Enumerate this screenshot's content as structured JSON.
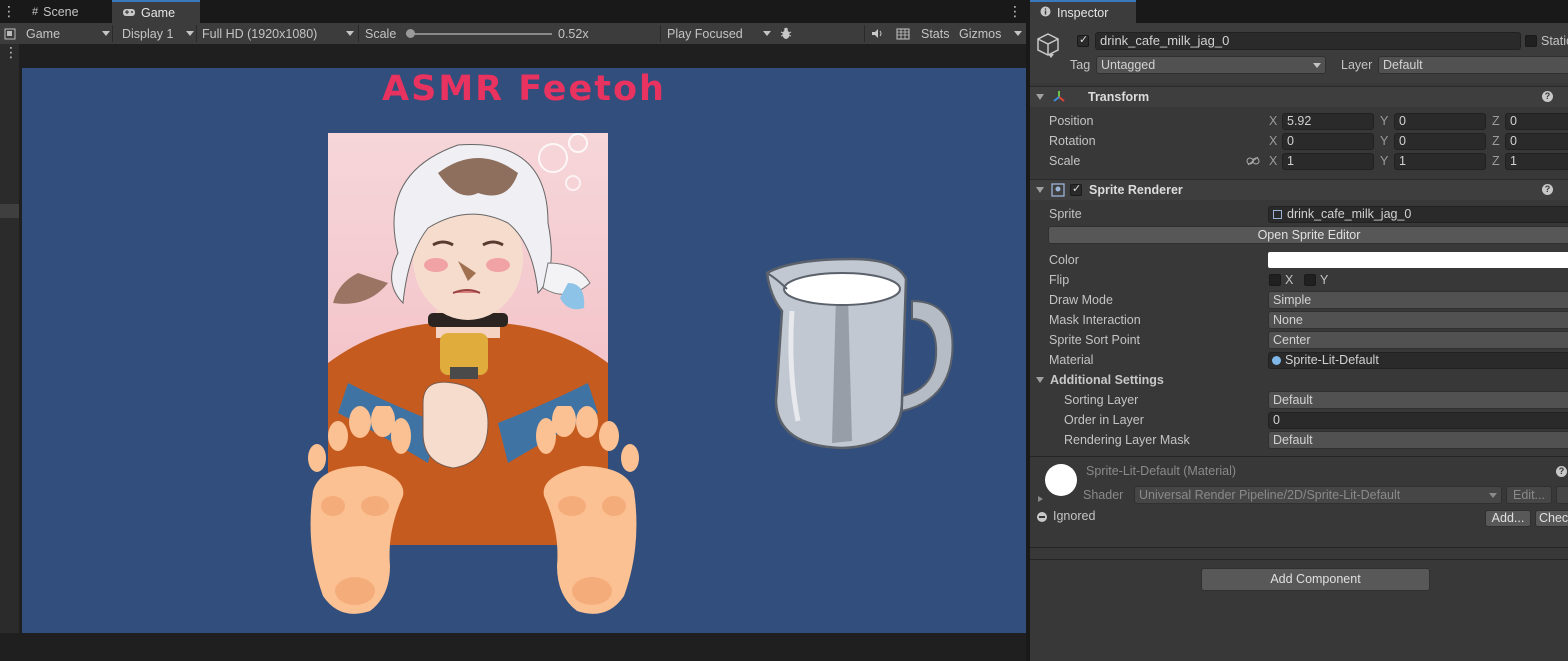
{
  "tabs": {
    "scene_label": "Scene",
    "game_label": "Game"
  },
  "toolbar": {
    "mode": "Game",
    "display": "Display 1",
    "resolution": "Full HD (1920x1080)",
    "scale_label": "Scale",
    "scale_value": "0.52x",
    "scale_fraction": 0.03,
    "play_mode": "Play Focused",
    "stats_label": "Stats",
    "gizmos_label": "Gizmos"
  },
  "game": {
    "title": "ASMR Feetoh",
    "background_color": "#324e7c",
    "title_color": "#e8325f"
  },
  "inspector": {
    "tab_label": "Inspector",
    "object_name": "drink_cafe_milk_jag_0",
    "static_label": "Static",
    "tag_label": "Tag",
    "tag_value": "Untagged",
    "layer_label": "Layer",
    "layer_value": "Default",
    "transform": {
      "title": "Transform",
      "position_label": "Position",
      "rotation_label": "Rotation",
      "scale_label": "Scale",
      "position": {
        "x": "5.92",
        "y": "0",
        "z": "0"
      },
      "rotation": {
        "x": "0",
        "y": "0",
        "z": "0"
      },
      "scale": {
        "x": "1",
        "y": "1",
        "z": "1"
      },
      "axis_x": "X",
      "axis_y": "Y",
      "axis_z": "Z"
    },
    "sprite_renderer": {
      "title": "Sprite Renderer",
      "sprite_label": "Sprite",
      "sprite_value": "drink_cafe_milk_jag_0",
      "open_editor_label": "Open Sprite Editor",
      "color_label": "Color",
      "color_value": "#ffffff",
      "flip_label": "Flip",
      "flip_x": "X",
      "flip_y": "Y",
      "draw_mode_label": "Draw Mode",
      "draw_mode_value": "Simple",
      "mask_label": "Mask Interaction",
      "mask_value": "None",
      "sort_point_label": "Sprite Sort Point",
      "sort_point_value": "Center",
      "material_label": "Material",
      "material_value": "Sprite-Lit-Default",
      "additional_label": "Additional Settings",
      "sorting_layer_label": "Sorting Layer",
      "sorting_layer_value": "Default",
      "order_label": "Order in Layer",
      "order_value": "0",
      "rendering_mask_label": "Rendering Layer Mask",
      "rendering_mask_value": "Default"
    },
    "material": {
      "title": "Sprite-Lit-Default (Material)",
      "shader_label": "Shader",
      "shader_value": "Universal Render Pipeline/2D/Sprite-Lit-Default",
      "edit_label": "Edit...",
      "ignored_label": "Ignored",
      "add_label": "Add...",
      "check_label": "Chec"
    },
    "add_component_label": "Add Component"
  }
}
